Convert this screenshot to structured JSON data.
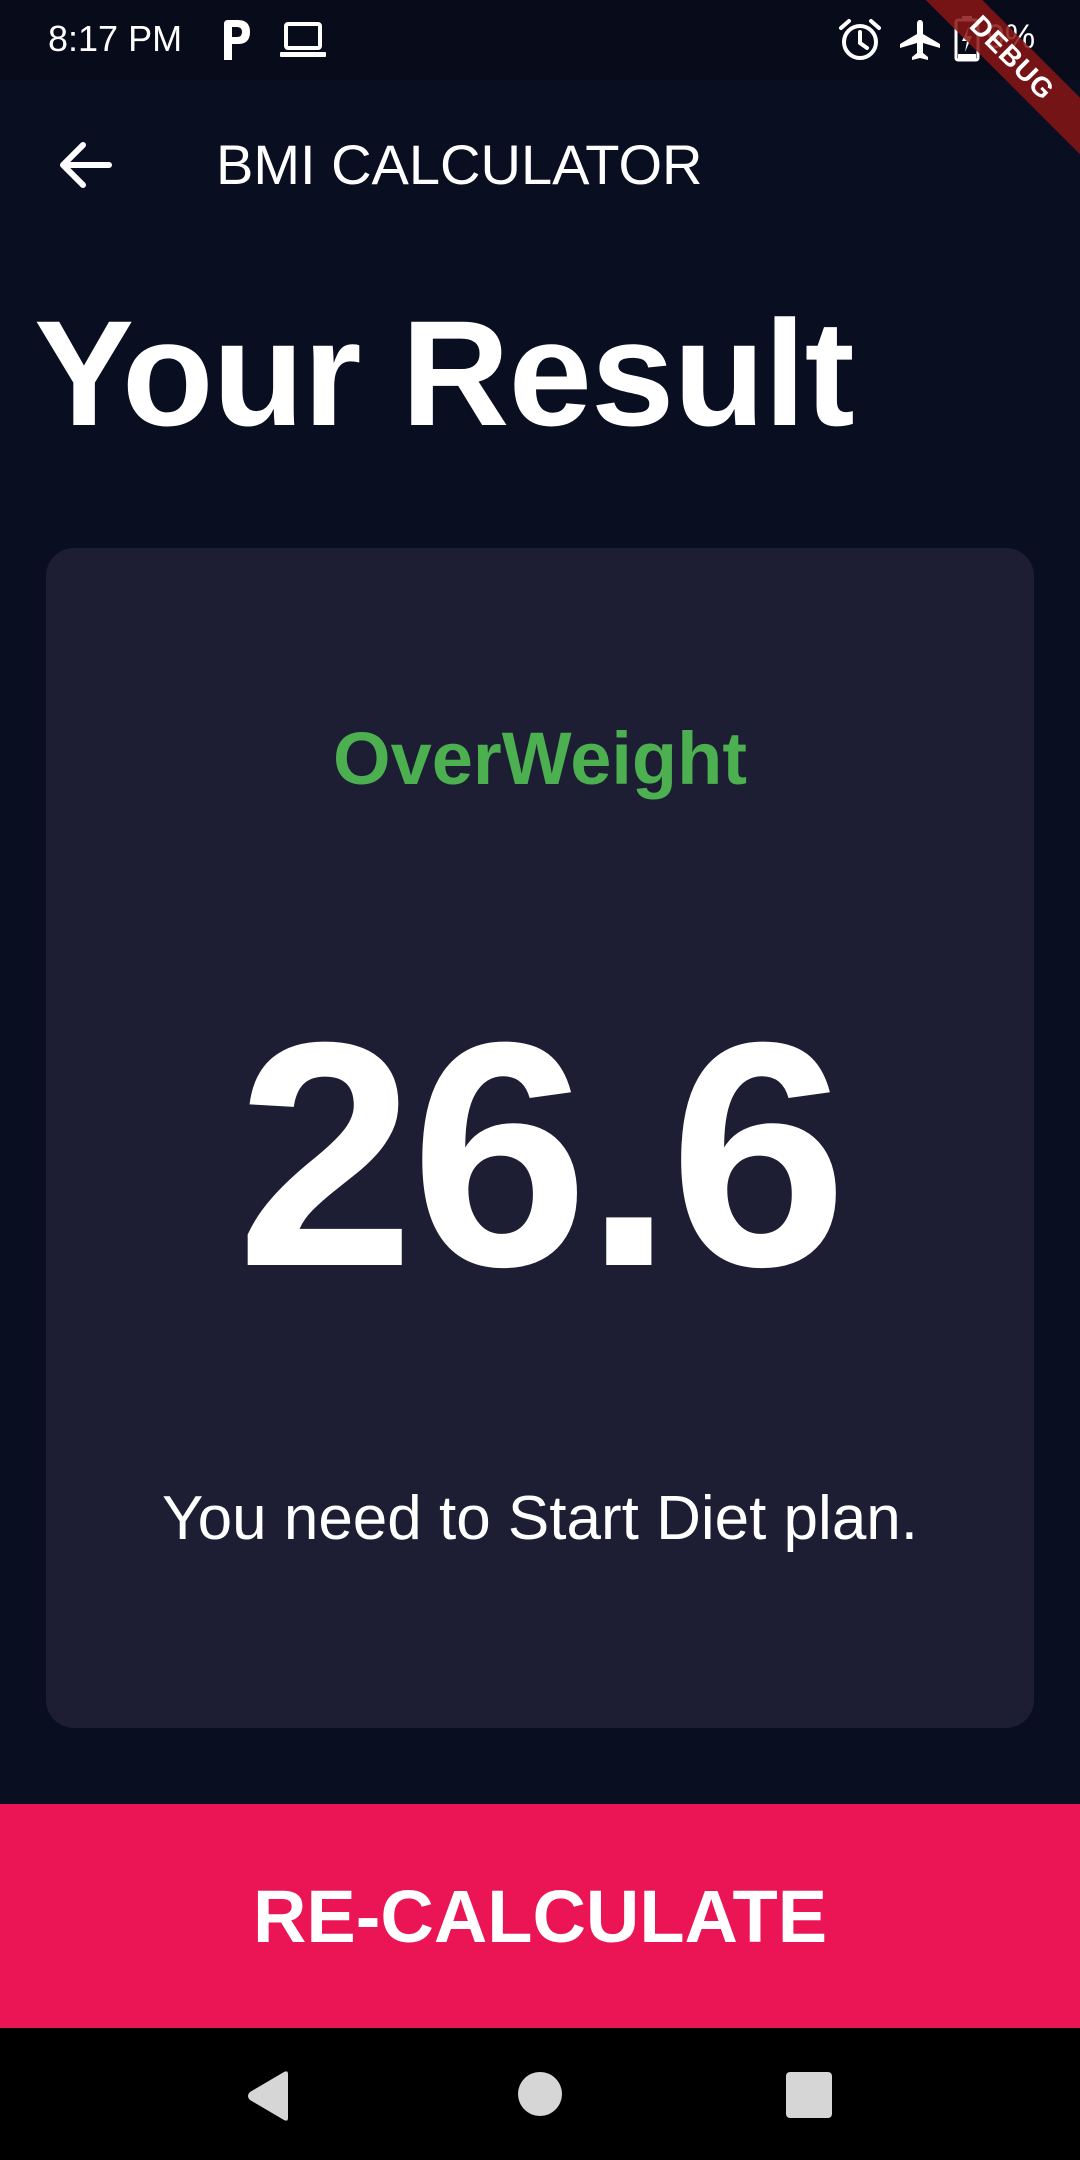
{
  "status_bar": {
    "time": "8:17 PM",
    "battery": "9%",
    "icons": [
      "p-app-icon",
      "laptop-icon",
      "alarm-icon",
      "airplane-icon",
      "battery-charging-icon"
    ]
  },
  "debug_banner": "DEBUG",
  "app_bar": {
    "title": "BMI CALCULATOR",
    "back_icon": "arrow-back-icon"
  },
  "page": {
    "title": "Your Result"
  },
  "result": {
    "status": "OverWeight",
    "value": "26.6",
    "message": "You need to Start Diet plan.",
    "status_color": "#4caf50",
    "card_color": "#1d1e33"
  },
  "action": {
    "label": "RE-CALCULATE",
    "color": "#eb1555"
  },
  "nav_bar": {
    "icons": [
      "nav-back-icon",
      "nav-home-icon",
      "nav-recents-icon"
    ]
  },
  "colors": {
    "background": "#0a0e21",
    "text": "#ffffff"
  }
}
